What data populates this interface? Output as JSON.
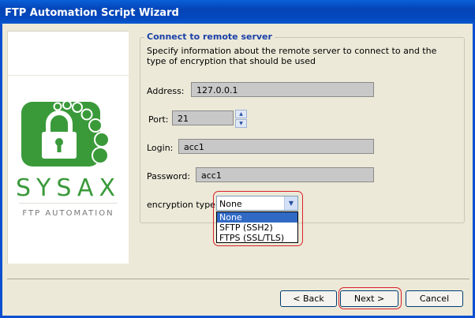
{
  "window": {
    "title": "FTP Automation Script Wizard"
  },
  "branding": {
    "name": "SYSAX",
    "subtitle": "FTP AUTOMATION",
    "color": "#3a9a3a"
  },
  "section": {
    "title": "Connect to remote server",
    "description": "Specify information about the remote server to connect to and the type of encryption that should be used"
  },
  "form": {
    "address_label": "Address:",
    "address_value": "127.0.0.1",
    "port_label": "Port:",
    "port_value": "21",
    "login_label": "Login:",
    "login_value": "acc1",
    "password_label": "Password:",
    "password_value": "acc1",
    "encryption_label": "encryption type:",
    "encryption_value": "None",
    "encryption_options": [
      "None",
      "SFTP (SSH2)",
      "FTPS (SSL/TLS)"
    ]
  },
  "buttons": {
    "back": "< Back",
    "next": "Next >",
    "cancel": "Cancel"
  },
  "colors": {
    "highlight": "#d9202a",
    "selection": "#316ac5",
    "titlebar": "#0444b6"
  }
}
